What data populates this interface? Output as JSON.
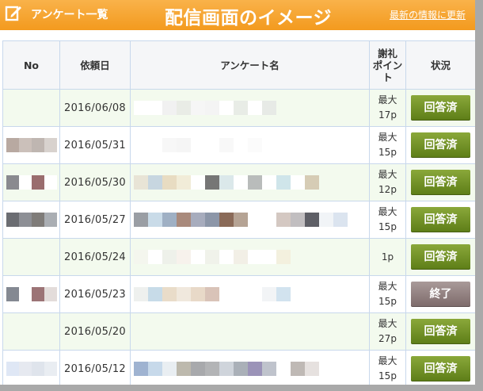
{
  "header": {
    "list_title": "アンケート一覧",
    "main_title": "配信画面のイメージ",
    "update_link": "最新の情報に更新",
    "icon": "checklist-pencil-icon"
  },
  "table": {
    "columns": [
      "No",
      "依頼日",
      "アンケート名",
      "謝礼\nポイント",
      "状況"
    ],
    "rows": [
      {
        "date": "2016/06/08",
        "points_prefix": "最大",
        "points": "17p",
        "status": "回答済",
        "status_kind": "answered",
        "no_blur": [],
        "name_blur": [
          "#ffffff",
          "#ffffff",
          "#f1f1f1",
          "#e9ece6",
          "#f6f6f6",
          "#f4f4f4",
          "#ffffff",
          "#e8ece6",
          "#ffffff",
          "#e7eae6"
        ]
      },
      {
        "date": "2016/05/31",
        "points_prefix": "最大",
        "points": "15p",
        "status": "回答済",
        "status_kind": "answered",
        "no_blur": [
          "#b8a9a1",
          "#cbc0ba",
          "#bfb6b1",
          "#d8d2ce"
        ],
        "name_blur": [
          "#ffffff",
          "#ffffff",
          "#f7f7f7",
          "#f5f5f5",
          "#ffffff",
          "#ffffff",
          "#f8f8f8",
          "#ffffff",
          "#fbfbfb",
          "#ffffff"
        ]
      },
      {
        "date": "2016/05/30",
        "points_prefix": "最大",
        "points": "12p",
        "status": "回答済",
        "status_kind": "answered",
        "no_blur": [
          "#8a8a8f",
          "#ffffff",
          "#9a6d6e",
          "#ffffff"
        ],
        "name_blur": [
          "#e8e4d6",
          "#c7d6e0",
          "#e8dcc2",
          "#f1ecd8",
          "#ffffff",
          "#767676",
          "#dbe8ea",
          "#ffffff",
          "#b9bcbb",
          "#ffffff",
          "#cfe5ea",
          "#ffffff",
          "#d6ccb5"
        ]
      },
      {
        "date": "2016/05/27",
        "points_prefix": "最大",
        "points": "15p",
        "status": "回答済",
        "status_kind": "answered",
        "no_blur": [
          "#6b6d72",
          "#8d8f95",
          "#7f7c79",
          "#aaaeb3"
        ],
        "name_blur": [
          "#9a9ea4",
          "#c9dbe8",
          "#9fb0c4",
          "#a98a7c",
          "#a7acbd",
          "#8c96a8",
          "#8a6a58",
          "#b5a394",
          "#ffffff",
          "#ffffff",
          "#d4c8c2",
          "#c1bec0",
          "#5e5f66",
          "#f1f4f7",
          "#dbe4ef"
        ]
      },
      {
        "date": "2016/05/24",
        "points_prefix": "",
        "points": "1p",
        "status": "回答済",
        "status_kind": "answered",
        "no_blur": [],
        "name_blur": [
          "#f4f6ee",
          "#ffffff",
          "#eef1ea",
          "#f7f2ec",
          "#ffffff",
          "#f0f2ea",
          "#ffffff",
          "#f2efe6",
          "#ffffff",
          "#ffffff",
          "#f3f0de"
        ]
      },
      {
        "date": "2016/05/23",
        "points_prefix": "最大",
        "points": "15p",
        "status": "終了",
        "status_kind": "closed",
        "no_blur": [
          "#848992",
          "#ffffff",
          "#9c7476",
          "#e3dcda"
        ],
        "name_blur": [
          "#eef0ee",
          "#c7dbe8",
          "#e9dcc9",
          "#f0e8dd",
          "#e8d9c8",
          "#d9c3b8",
          "#ffffff",
          "#ffffff",
          "#ffffff",
          "#f2f4f6",
          "#d2e3ef"
        ]
      },
      {
        "date": "2016/05/20",
        "points_prefix": "最大",
        "points": "27p",
        "status": "回答済",
        "status_kind": "answered",
        "no_blur": [],
        "name_blur": []
      },
      {
        "date": "2016/05/12",
        "points_prefix": "最大",
        "points": "15p",
        "status": "回答済",
        "status_kind": "answered",
        "no_blur": [
          "#dfe7f5",
          "#e6e9f0",
          "#dfe4ec",
          "#e9edf2"
        ],
        "name_blur": [
          "#9fb3d1",
          "#c7d9ea",
          "#e9eef2",
          "#bdb9ad",
          "#a8a9ac",
          "#b3b4b6",
          "#cfd4db",
          "#aab0b8",
          "#9b93b8",
          "#bfc3cc",
          "#ffffff",
          "#bfb9b5",
          "#e6e1df"
        ]
      }
    ]
  }
}
